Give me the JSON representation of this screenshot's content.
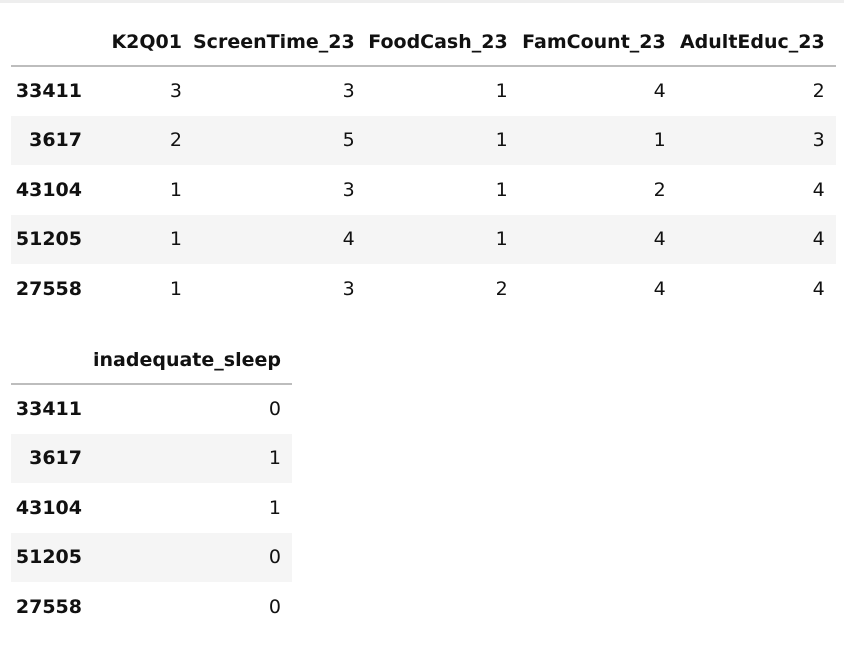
{
  "table_1": {
    "columns": [
      "",
      "K2Q01",
      "ScreenTime_23",
      "FoodCash_23",
      "FamCount_23",
      "AdultEduc_23"
    ],
    "rows": [
      {
        "index": "33411",
        "values": [
          "3",
          "3",
          "1",
          "4",
          "2"
        ]
      },
      {
        "index": "3617",
        "values": [
          "2",
          "5",
          "1",
          "1",
          "3"
        ]
      },
      {
        "index": "43104",
        "values": [
          "1",
          "3",
          "1",
          "2",
          "4"
        ]
      },
      {
        "index": "51205",
        "values": [
          "1",
          "4",
          "1",
          "4",
          "4"
        ]
      },
      {
        "index": "27558",
        "values": [
          "1",
          "3",
          "2",
          "4",
          "4"
        ]
      }
    ]
  },
  "table_2": {
    "columns": [
      "",
      "inadequate_sleep"
    ],
    "rows": [
      {
        "index": "33411",
        "values": [
          "0"
        ]
      },
      {
        "index": "3617",
        "values": [
          "1"
        ]
      },
      {
        "index": "43104",
        "values": [
          "1"
        ]
      },
      {
        "index": "51205",
        "values": [
          "0"
        ]
      },
      {
        "index": "27558",
        "values": [
          "0"
        ]
      }
    ]
  }
}
